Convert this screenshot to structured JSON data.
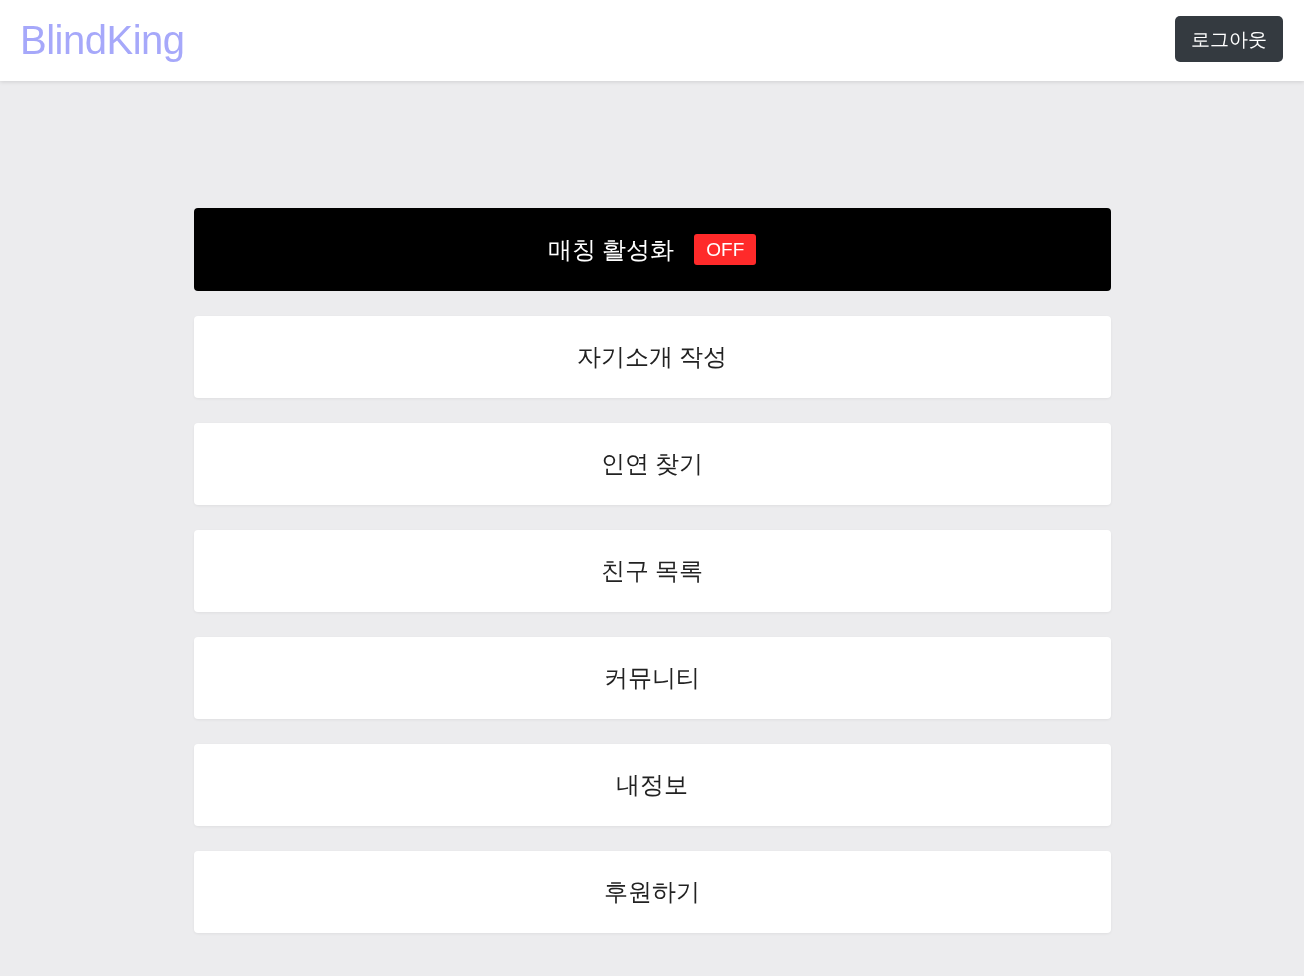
{
  "header": {
    "logo": "BlindKing",
    "logout_button": "로그아웃"
  },
  "matching_toggle": {
    "label": "매칭 활성화",
    "status": "OFF",
    "on": false
  },
  "menu_items": [
    "자기소개 작성",
    "인연 찾기",
    "친구 목록",
    "커뮤니티",
    "내정보",
    "후원하기"
  ]
}
